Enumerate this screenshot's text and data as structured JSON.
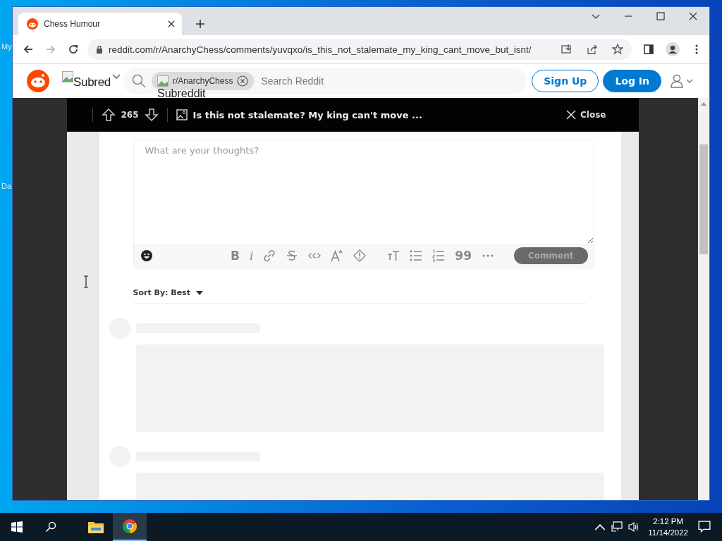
{
  "desktop": {
    "icon_labels": [
      "My",
      "Da"
    ]
  },
  "browser": {
    "tabs": [
      {
        "title": "Chess Humour",
        "selected": true
      }
    ],
    "url": "reddit.com/r/AnarchyChess/comments/yuvqxo/is_this_not_stalemate_my_king_cant_move_but_isnt/"
  },
  "reddit_header": {
    "logo_alt": "Subred",
    "community_chip": "r/AnarchyChess",
    "chip_alt": "Subreddit",
    "search_placeholder": "Search Reddit",
    "sign_up": "Sign Up",
    "log_in": "Log In"
  },
  "post_bar": {
    "votes": "265",
    "title": "Is this not stalemate? My king can't move ...",
    "close": "Close"
  },
  "comment_box": {
    "placeholder": "What are your thoughts?",
    "submit": "Comment",
    "submit_disabled": true,
    "tools": [
      {
        "kind": "text",
        "symbol": "B"
      },
      {
        "kind": "italic",
        "symbol": "i"
      },
      {
        "kind": "link"
      },
      {
        "kind": "strike"
      },
      {
        "kind": "code"
      },
      {
        "kind": "superscript"
      },
      {
        "kind": "spoiler"
      },
      {
        "kind": "heading"
      },
      {
        "kind": "bullets"
      },
      {
        "kind": "numbers"
      },
      {
        "kind": "text",
        "symbol": "99"
      },
      {
        "kind": "more"
      }
    ]
  },
  "sort": {
    "label": "Sort By: Best"
  },
  "taskbar": {
    "time": "2:12 PM",
    "date": "11/14/2022",
    "apps": [
      {
        "kind": "explorer",
        "active": false
      },
      {
        "kind": "chrome",
        "active": true
      }
    ]
  }
}
